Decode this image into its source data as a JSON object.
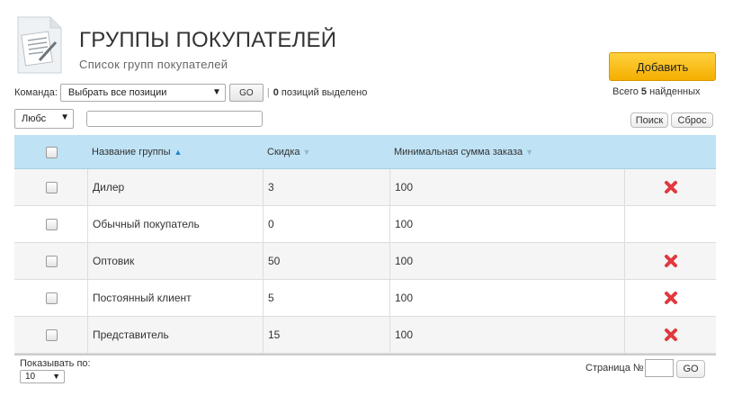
{
  "header": {
    "title": "ГРУППЫ ПОКУПАТЕЛЕЙ",
    "subtitle": "Список групп покупателей",
    "page_icon": "document-icon"
  },
  "actions": {
    "add_label": "Добавить",
    "found_prefix": "Всего",
    "found_count": "5",
    "found_suffix": "найденных"
  },
  "command_bar": {
    "label": "Команда:",
    "selected_option": "Выбрать все позиции",
    "go_label": "GO",
    "separator": "|",
    "selected_count": "0",
    "selected_suffix": "позиций выделено"
  },
  "filter": {
    "scope_option": "Любс",
    "search_value": "",
    "search_label": "Поиск",
    "reset_label": "Сброс"
  },
  "table": {
    "columns": [
      {
        "label": "Название группы",
        "sort": "asc"
      },
      {
        "label": "Скидка",
        "sort": "none"
      },
      {
        "label": "Минимальная сумма заказа",
        "sort": "none"
      }
    ],
    "rows": [
      {
        "name": "Дилер",
        "discount": "3",
        "min_order": "100",
        "deletable": true
      },
      {
        "name": "Обычный покупатель",
        "discount": "0",
        "min_order": "100",
        "deletable": false
      },
      {
        "name": "Оптовик",
        "discount": "50",
        "min_order": "100",
        "deletable": true
      },
      {
        "name": "Постоянный клиент",
        "discount": "5",
        "min_order": "100",
        "deletable": true
      },
      {
        "name": "Представитель",
        "discount": "15",
        "min_order": "100",
        "deletable": true
      }
    ]
  },
  "footer": {
    "per_page_label": "Показывать по:",
    "per_page_value": "10",
    "page_label": "Страница №",
    "page_value": "",
    "go_label": "GO"
  },
  "colors": {
    "header_bg": "#bfe2f5",
    "add_button": "#f7b500",
    "delete_icon": "#e0393e",
    "sort_active": "#1e88c9"
  }
}
